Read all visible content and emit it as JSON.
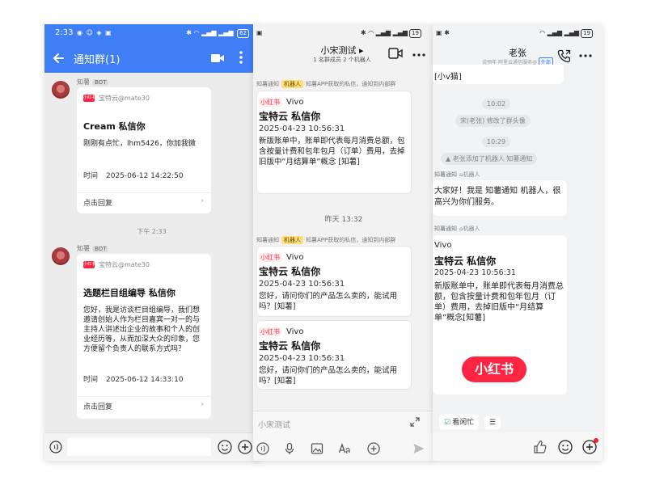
{
  "phone1": {
    "status": {
      "time": "2:33",
      "left_icons": "◉ ☺ ◈ ▣",
      "right_icons": "✱ ◠ ▂▄▆ ▂▄▆",
      "battery": "62"
    },
    "appbar": {
      "title": "通知群(1)"
    },
    "messages": [
      {
        "sender": "知薯",
        "bot_tag": "BOT",
        "source": "宝特云@mate30",
        "title": "Cream 私信你",
        "body": "刚刚有点忙，lhm5426，你加我微",
        "time_label": "时间",
        "time_value": "2025-06-12 14:22:50",
        "reply": "点击回复"
      },
      {
        "sender": "知薯",
        "bot_tag": "BOT",
        "source": "宝特云@mate30",
        "title": "选题栏目组编导 私信你",
        "body": "您好，我是访谈栏目组编导，我们想邀请创始人作为栏目嘉宾一对一的与主持人讲述出企业的故事和个人的创业经历等，从而加深大众的印象，您方便留个负责人的联系方式吗？",
        "time_label": "时间",
        "time_value": "2025-06-12 14:33:10",
        "reply": "点击回复"
      }
    ],
    "divider": "下午 2:33",
    "brand_mini": "小红书"
  },
  "phone2": {
    "status": {
      "left_icons": "▣",
      "right_icons": "✱ ◠ ▂▄▆ ▂▄▆",
      "battery": "19"
    },
    "header": {
      "title": "小宋测试 ▸",
      "subtitle": "1 名群成员   2 个机器人"
    },
    "msg_meta_prefix": "知薯通知",
    "robot_tag": "机器人",
    "msg_meta_suffix": "知薯APP获取的私信，通知到内部群",
    "cards": [
      {
        "brand": "小红书",
        "from": "Vivo",
        "title": "宝特云 私信你",
        "date": "2025-04-23 10:56:31",
        "body": "新版账单中，账单即代表每月消费总额，包含按量计费和包年包月（订单）费用，去掉旧版中“月结算单”概念 [知薯]"
      },
      {
        "brand": "小红书",
        "from": "Vivo",
        "title": "宝特云 私信你",
        "date": "2025-04-23 10:56:31",
        "body": "您好，请问你们的产品怎么卖的，能试用吗？[知薯]"
      },
      {
        "brand": "小红书",
        "from": "Vivo",
        "title": "宝特云 私信你",
        "date": "2025-04-23 10:56:31",
        "body": "您好，请问你们的产品怎么卖的，能试用吗？[知薯]"
      }
    ],
    "day_divider": "昨天 13:32",
    "input_placeholder": "小宋测试"
  },
  "phone3": {
    "status": {
      "left_icons": "▣ ✱",
      "right_icons": "◠ ▂▄▆ ▂▄▆",
      "battery": "19"
    },
    "header": {
      "title": "老张",
      "subtitle": "说预年 阿里云通信服务@",
      "ext_tag": "外部"
    },
    "prev_bubble": "[小v猫]",
    "time1": "10:02",
    "event1": "宋(老张) 修改了群头像",
    "time2": "10:29",
    "event2": "老张添加了机器人 知薯通知",
    "meta1": {
      "name": "知薯通知",
      "robot": "机器人"
    },
    "bubble1": "大家好！我是 知薯通知 机器人，很高兴为你们服务。",
    "meta2": {
      "name": "知薯通知",
      "robot": "机器人"
    },
    "bubble2": {
      "from": "Vivo",
      "title": "宝特云 私信你",
      "date": "2025-04-23 10:56:31",
      "body": "新版账单中，账单即代表每月消费总额，包含按量计费和包年包月（订单）费用，去掉旧版中“月结算单”概念[知薯]",
      "brand": "小红书"
    },
    "chip1": "看闲忙",
    "chip2": "☰"
  }
}
